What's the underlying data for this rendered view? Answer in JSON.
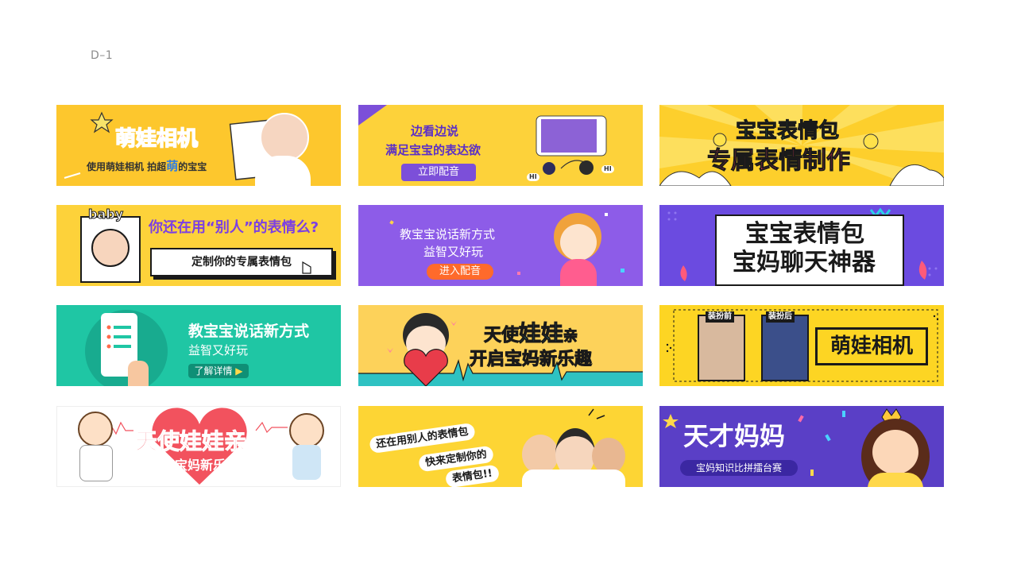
{
  "page_label": "D–1",
  "banners": {
    "b1": {
      "title": "萌娃相机",
      "subtitle_a": "使用萌娃相机 拍超",
      "subtitle_hl": "萌",
      "subtitle_b": "的宝宝",
      "bg": "#fdc72d"
    },
    "b2": {
      "line1": "边看边说",
      "line2": "满足宝宝的表达欲",
      "button": "立即配音",
      "bubble_a": "HI",
      "bubble_b": "HI",
      "bg": "#fdd23a"
    },
    "b3": {
      "line1": "宝宝表情包",
      "line2": "专属表情制作",
      "bg": "#fdcf2c"
    },
    "b4": {
      "badge": "baby",
      "question": "你还在用“别人”的表情么?",
      "box": "定制你的专属表情包",
      "bg": "#fdd23a"
    },
    "b5": {
      "line1": "教宝宝说话新方式",
      "line2": "益智又好玩",
      "button": "进入配音",
      "bg": "#8d5ce8"
    },
    "b6": {
      "line1": "宝宝表情包",
      "line2": "宝妈聊天神器",
      "bg": "#6b4be0"
    },
    "b7": {
      "line1": "教宝宝说话新方式",
      "line2": "益智又好玩",
      "button": "了解详情",
      "bg": "#1fc6a4"
    },
    "b8": {
      "line1a": "天使",
      "line1b": "娃娃",
      "line1c": "亲",
      "line2": "开启宝妈新乐趣",
      "bg": "#fdd25a"
    },
    "b9": {
      "before": "装扮前",
      "after": "装扮后",
      "title": "萌娃相机",
      "bg": "#fdd523"
    },
    "b10": {
      "title": "天使娃娃亲",
      "subtitle": "开启宝妈新乐趣",
      "bg": "#ffffff"
    },
    "b11": {
      "line1": "还在用别人的表情包",
      "line2": "快来定制你的",
      "line3": "表情包!!",
      "bg": "#fdd534"
    },
    "b12": {
      "title": "天才妈妈",
      "pill": "宝妈知识比拼擂台赛",
      "bg": "#5a3fc6"
    }
  }
}
